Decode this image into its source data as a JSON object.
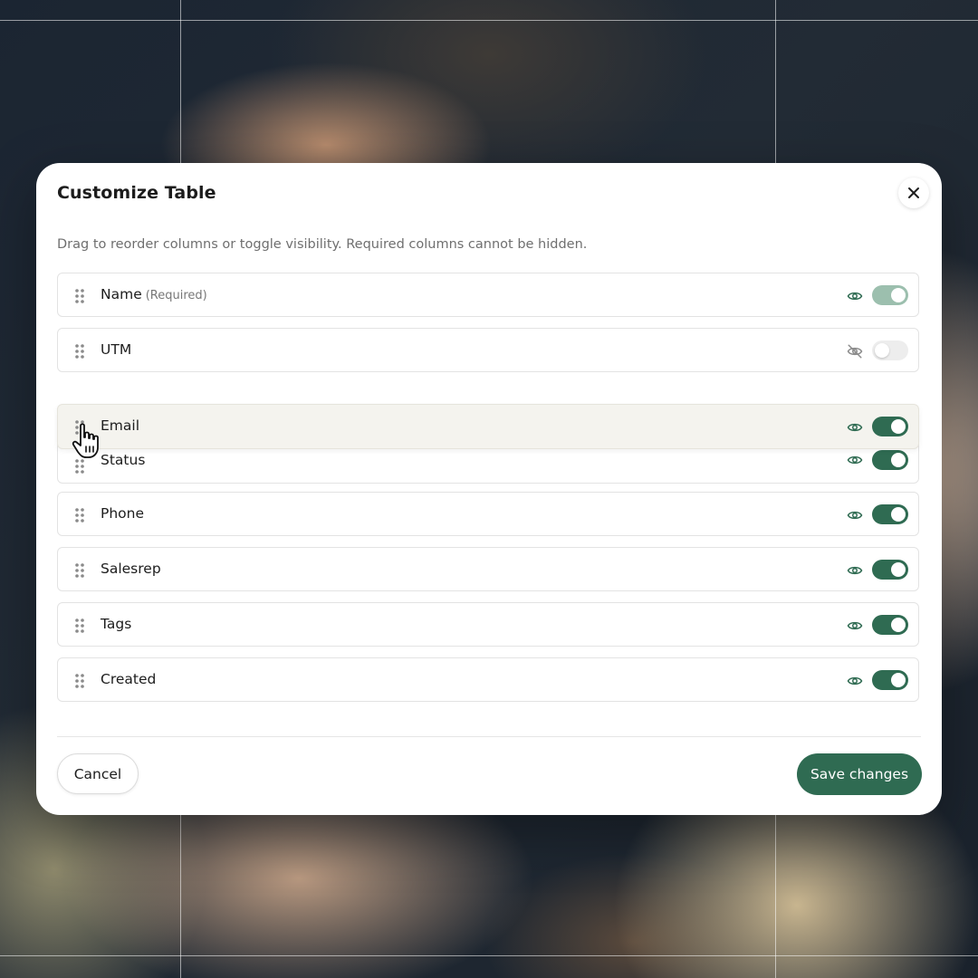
{
  "modal": {
    "title": "Customize Table",
    "subtitle": "Drag to reorder columns or toggle visibility. Required columns cannot be hidden.",
    "close_icon": "close-icon"
  },
  "columns": [
    {
      "label": "Name",
      "note": "(Required)",
      "visible": true,
      "required": true
    },
    {
      "label": "UTM",
      "visible": false
    },
    {
      "label": "Email",
      "visible": true,
      "state": "dragging"
    },
    {
      "label": "Status",
      "visible": true
    },
    {
      "label": "Phone",
      "visible": true
    },
    {
      "label": "Salesrep",
      "visible": true
    },
    {
      "label": "Tags",
      "visible": true
    },
    {
      "label": "Created",
      "visible": true
    }
  ],
  "footer": {
    "cancel_label": "Cancel",
    "save_label": "Save changes"
  },
  "colors": {
    "accent": "#2f6b52",
    "accent_disabled": "#9cbfae",
    "toggle_off": "#ededed",
    "drag_row": "#f4f3ee"
  },
  "icons": {
    "handle": "drag-handle-icon",
    "visible": "eye-icon",
    "hidden": "eye-off-icon",
    "cursor": "grab-cursor-icon"
  }
}
